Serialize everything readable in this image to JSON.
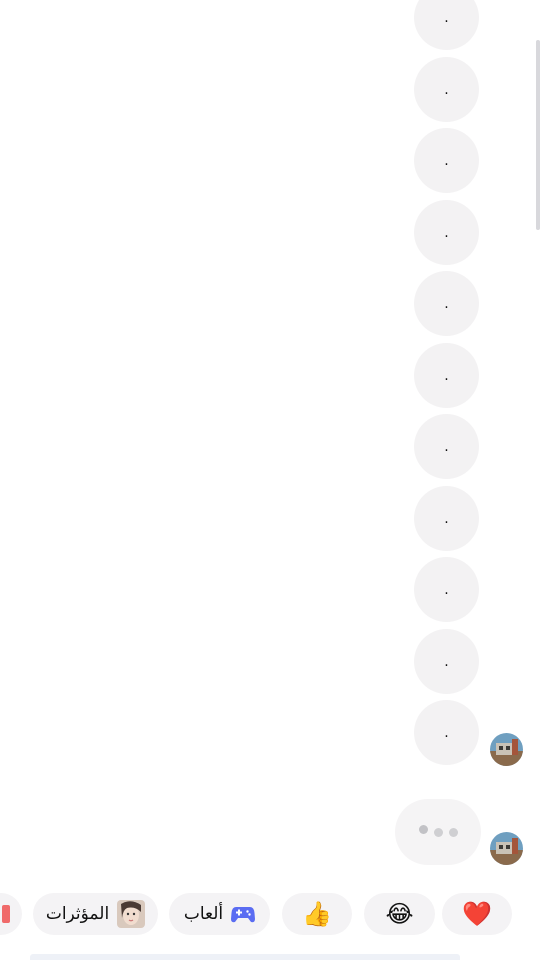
{
  "messages": [
    {
      "text": "."
    },
    {
      "text": "."
    },
    {
      "text": "."
    },
    {
      "text": "."
    },
    {
      "text": "."
    },
    {
      "text": "."
    },
    {
      "text": "."
    },
    {
      "text": "."
    },
    {
      "text": "."
    },
    {
      "text": "."
    },
    {
      "text": "."
    }
  ],
  "typing_indicator": {
    "dots": 3
  },
  "quick_replies": {
    "heart": {
      "emoji": "❤️",
      "icon": "heart-icon"
    },
    "laugh": {
      "emoji": "😂",
      "icon": "tears-of-joy-icon"
    },
    "like": {
      "emoji": "👍",
      "icon": "thumbs-up-icon"
    },
    "games": {
      "label": "ألعاب",
      "icon": "gamepad-icon"
    },
    "effects": {
      "label": "المؤثرات",
      "icon": "effects-thumbnail"
    }
  },
  "colors": {
    "bubble": "#f3f2f3",
    "gamepad": "#5a6cf2",
    "chip": "#f4f3f5"
  }
}
